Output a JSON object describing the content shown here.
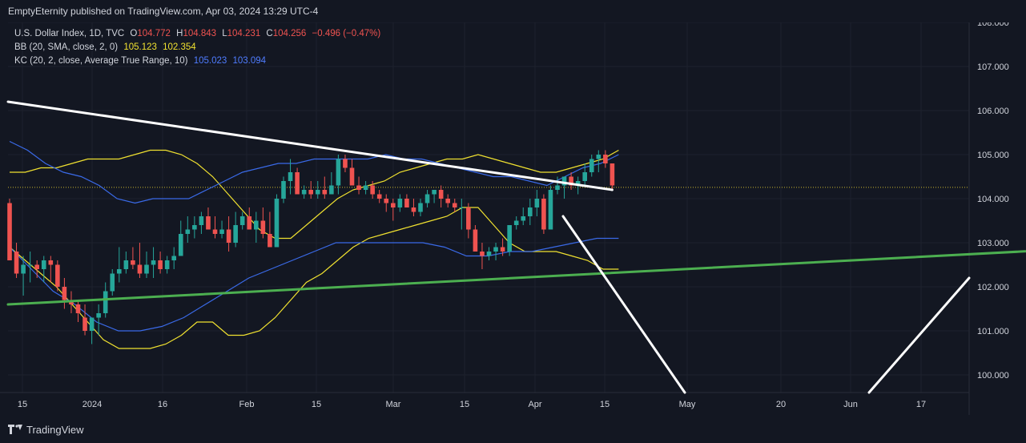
{
  "header": {
    "publisher": "EmptyEternity published on TradingView.com, Apr 03, 2024 13:29 UTC-4"
  },
  "legend": {
    "line1": {
      "symbol": "U.S. Dollar Index, 1D, TVC",
      "o_label": "O",
      "o": "104.772",
      "h_label": "H",
      "h": "104.843",
      "l_label": "L",
      "l": "104.231",
      "c_label": "C",
      "c": "104.256",
      "change": "−0.496 (−0.47%)"
    },
    "line2": {
      "label": "BB (20, SMA, close, 2, 0)",
      "v1": "105.123",
      "v2": "102.354"
    },
    "line3": {
      "label": "KC (20, 2, close, Average True Range, 10)",
      "v1": "105.023",
      "v2": "103.094"
    }
  },
  "footer": {
    "brand": "TradingView"
  },
  "colors": {
    "background": "#131722",
    "up": "#26a69a",
    "down": "#ef5350",
    "bb": "#f0e130",
    "kc": "#3a6ae8",
    "trend_white": "#ffffff",
    "trend_green": "#4caf50",
    "grid": "#1e222d",
    "text": "#d1d4dc"
  },
  "chart_data": {
    "type": "candlestick",
    "y_axis": {
      "min": 99.6,
      "max": 108.0,
      "ticks": [
        "108.000",
        "107.000",
        "106.000",
        "105.000",
        "104.000",
        "103.000",
        "102.000",
        "101.000",
        "100.000"
      ],
      "tick_values": [
        108,
        107,
        106,
        105,
        104,
        103,
        102,
        101,
        100
      ]
    },
    "x_axis": {
      "labels": [
        "15",
        "2024",
        "16",
        "Feb",
        "15",
        "Mar",
        "15",
        "Apr",
        "15",
        "May",
        "20",
        "Jun",
        "17"
      ]
    },
    "last_price": 104.256,
    "candles": [
      [
        103.9,
        104.0,
        102.6,
        102.6
      ],
      [
        102.8,
        103.0,
        102.2,
        102.3
      ],
      [
        102.3,
        102.7,
        101.8,
        102.5
      ],
      [
        102.5,
        102.8,
        102.1,
        102.5
      ],
      [
        102.5,
        102.6,
        102.2,
        102.4
      ],
      [
        102.4,
        102.7,
        102.1,
        102.6
      ],
      [
        102.6,
        102.7,
        102.1,
        102.5
      ],
      [
        102.5,
        102.6,
        101.9,
        102.0
      ],
      [
        102.0,
        102.2,
        101.5,
        101.7
      ],
      [
        101.7,
        101.9,
        101.4,
        101.6
      ],
      [
        101.6,
        101.7,
        101.2,
        101.4
      ],
      [
        101.3,
        101.6,
        100.9,
        101.0
      ],
      [
        101.0,
        101.3,
        100.7,
        101.3
      ],
      [
        101.3,
        101.6,
        100.9,
        101.4
      ],
      [
        101.4,
        102.1,
        101.3,
        101.9
      ],
      [
        101.9,
        102.4,
        101.8,
        102.3
      ],
      [
        102.3,
        102.9,
        102.1,
        102.4
      ],
      [
        102.4,
        102.8,
        102.3,
        102.6
      ],
      [
        102.6,
        102.9,
        102.4,
        102.5
      ],
      [
        102.5,
        103.0,
        102.2,
        102.3
      ],
      [
        102.3,
        102.8,
        102.2,
        102.5
      ],
      [
        102.5,
        102.9,
        102.2,
        102.6
      ],
      [
        102.6,
        102.8,
        102.3,
        102.4
      ],
      [
        102.4,
        102.7,
        102.3,
        102.6
      ],
      [
        102.6,
        102.9,
        102.4,
        102.7
      ],
      [
        102.7,
        103.5,
        102.7,
        103.2
      ],
      [
        103.2,
        103.6,
        103.0,
        103.3
      ],
      [
        103.3,
        103.6,
        103.1,
        103.4
      ],
      [
        103.4,
        103.7,
        103.2,
        103.6
      ],
      [
        103.6,
        103.8,
        103.3,
        103.3
      ],
      [
        103.3,
        103.6,
        103.1,
        103.2
      ],
      [
        103.2,
        103.5,
        103.1,
        103.3
      ],
      [
        103.3,
        103.6,
        102.8,
        103.0
      ],
      [
        103.0,
        103.7,
        102.9,
        103.4
      ],
      [
        103.4,
        103.7,
        103.3,
        103.6
      ],
      [
        103.6,
        103.8,
        103.3,
        103.3
      ],
      [
        103.3,
        103.7,
        103.0,
        103.5
      ],
      [
        103.5,
        103.8,
        103.1,
        103.2
      ],
      [
        103.2,
        103.7,
        102.9,
        102.9
      ],
      [
        102.9,
        104.1,
        102.9,
        104.0
      ],
      [
        104.0,
        104.5,
        103.9,
        104.4
      ],
      [
        104.4,
        104.9,
        104.1,
        104.6
      ],
      [
        104.6,
        104.7,
        104.1,
        104.1
      ],
      [
        104.1,
        104.3,
        104.0,
        104.2
      ],
      [
        104.2,
        104.4,
        104.0,
        104.1
      ],
      [
        104.1,
        104.4,
        104.0,
        104.2
      ],
      [
        104.2,
        104.5,
        104.0,
        104.1
      ],
      [
        104.1,
        104.6,
        104.1,
        104.3
      ],
      [
        104.3,
        105.0,
        104.1,
        104.9
      ],
      [
        104.9,
        105.0,
        104.6,
        104.7
      ],
      [
        104.7,
        104.9,
        104.3,
        104.3
      ],
      [
        104.3,
        104.5,
        104.1,
        104.2
      ],
      [
        104.2,
        104.4,
        104.1,
        104.3
      ],
      [
        104.3,
        104.4,
        104.0,
        104.1
      ],
      [
        104.1,
        104.2,
        103.9,
        104.0
      ],
      [
        104.0,
        104.1,
        103.7,
        103.9
      ],
      [
        103.9,
        104.0,
        103.5,
        103.8
      ],
      [
        103.8,
        104.1,
        103.7,
        104.0
      ],
      [
        104.0,
        104.1,
        103.8,
        103.8
      ],
      [
        103.8,
        104.0,
        103.6,
        103.7
      ],
      [
        103.7,
        104.0,
        103.6,
        103.9
      ],
      [
        103.9,
        104.2,
        103.8,
        104.1
      ],
      [
        104.1,
        104.2,
        103.9,
        104.2
      ],
      [
        104.2,
        104.3,
        103.8,
        104.0
      ],
      [
        104.0,
        104.1,
        103.8,
        103.9
      ],
      [
        103.9,
        104.0,
        103.7,
        103.8
      ],
      [
        103.8,
        104.0,
        103.3,
        103.8
      ],
      [
        103.8,
        103.9,
        103.1,
        103.3
      ],
      [
        103.3,
        103.4,
        102.8,
        102.8
      ],
      [
        102.8,
        103.0,
        102.4,
        102.7
      ],
      [
        102.7,
        102.9,
        102.6,
        102.8
      ],
      [
        102.8,
        103.0,
        102.6,
        102.9
      ],
      [
        102.9,
        103.1,
        102.7,
        102.8
      ],
      [
        102.8,
        103.4,
        102.7,
        103.4
      ],
      [
        103.4,
        103.6,
        103.3,
        103.5
      ],
      [
        103.5,
        103.8,
        103.4,
        103.6
      ],
      [
        103.6,
        104.0,
        103.4,
        103.8
      ],
      [
        103.8,
        104.2,
        103.6,
        104.0
      ],
      [
        104.0,
        104.1,
        103.2,
        103.3
      ],
      [
        103.3,
        104.3,
        103.3,
        104.2
      ],
      [
        104.2,
        104.5,
        104.1,
        104.3
      ],
      [
        104.3,
        104.5,
        104.0,
        104.5
      ],
      [
        104.5,
        104.6,
        104.2,
        104.3
      ],
      [
        104.3,
        104.5,
        104.1,
        104.4
      ],
      [
        104.4,
        104.8,
        104.3,
        104.6
      ],
      [
        104.6,
        105.0,
        104.5,
        104.9
      ],
      [
        104.9,
        105.1,
        104.6,
        105.0
      ],
      [
        105.0,
        105.1,
        104.7,
        104.8
      ],
      [
        104.8,
        104.8,
        104.2,
        104.3
      ]
    ],
    "bollinger_upper": [
      104.6,
      104.6,
      104.7,
      104.7,
      104.8,
      104.9,
      104.9,
      104.9,
      105.0,
      105.1,
      105.1,
      105.0,
      104.8,
      104.5,
      104.1,
      103.7,
      103.3,
      103.1,
      103.1,
      103.4,
      103.7,
      104.0,
      104.2,
      104.3,
      104.4,
      104.6,
      104.7,
      104.8,
      104.9,
      104.9,
      105.0,
      104.9,
      104.8,
      104.7,
      104.6,
      104.6,
      104.7,
      104.8,
      104.9,
      105.1
    ],
    "bollinger_lower": [
      102.9,
      102.6,
      102.3,
      102.0,
      101.6,
      101.2,
      100.8,
      100.6,
      100.6,
      100.6,
      100.7,
      100.9,
      101.2,
      101.2,
      100.9,
      100.9,
      101.0,
      101.3,
      101.7,
      102.1,
      102.3,
      102.6,
      102.9,
      103.1,
      103.2,
      103.3,
      103.4,
      103.5,
      103.6,
      103.8,
      103.8,
      103.4,
      103.0,
      102.8,
      102.8,
      102.8,
      102.7,
      102.6,
      102.4,
      102.4
    ],
    "keltner_upper": [
      105.3,
      105.1,
      104.8,
      104.6,
      104.5,
      104.3,
      104.0,
      103.9,
      104.0,
      104.0,
      104.0,
      104.2,
      104.4,
      104.6,
      104.7,
      104.8,
      104.8,
      104.9,
      104.9,
      104.9,
      104.9,
      105.0,
      104.9,
      104.9,
      104.8,
      104.7,
      104.6,
      104.5,
      104.5,
      104.4,
      104.3,
      104.5,
      104.7,
      104.8,
      105.0
    ],
    "keltner_lower": [
      102.9,
      102.4,
      101.9,
      101.6,
      101.2,
      101.0,
      101.0,
      101.1,
      101.3,
      101.6,
      101.9,
      102.2,
      102.4,
      102.6,
      102.8,
      103.0,
      103.0,
      103.0,
      103.0,
      103.0,
      102.9,
      102.7,
      102.7,
      102.8,
      102.8,
      102.9,
      103.0,
      103.1,
      103.1
    ],
    "trendlines": [
      {
        "color": "white",
        "from": [
          0,
          106.2
        ],
        "to": [
          88,
          104.2
        ]
      },
      {
        "color": "green",
        "from": [
          0,
          101.6
        ],
        "to": [
          160,
          102.9
        ]
      },
      {
        "color": "white",
        "from": [
          "projection_start",
          103.6
        ],
        "to": [
          "May",
          99.6
        ]
      },
      {
        "color": "white",
        "from": [
          "Jun",
          99.6
        ],
        "to": [
          "end",
          102.2
        ]
      }
    ]
  }
}
